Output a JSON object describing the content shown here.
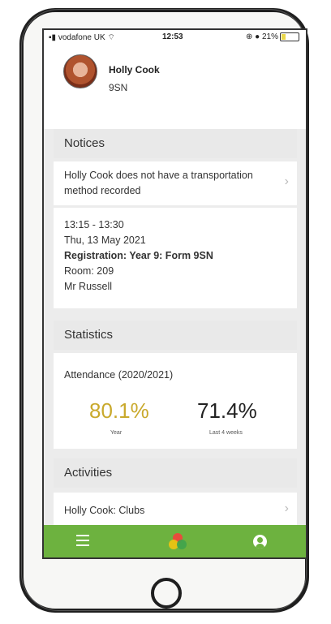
{
  "status_bar": {
    "carrier": "vodafone UK",
    "time": "12:53",
    "battery": "21%"
  },
  "profile": {
    "name": "Holly Cook",
    "form": "9SN"
  },
  "notices": {
    "title": "Notices",
    "transport_notice": "Holly Cook does not have a transportation method recorded",
    "registration": {
      "time": "13:15 - 13:30",
      "date": "Thu, 13 May 2021",
      "event": "Registration: Year 9: Form 9SN",
      "room": "Room: 209",
      "teacher": "Mr Russell"
    }
  },
  "statistics": {
    "title": "Statistics",
    "attendance_label": "Attendance (2020/2021)",
    "year_value": "80.1%",
    "year_label": "Year",
    "recent_value": "71.4%",
    "recent_label": "Last 4 weeks"
  },
  "activities": {
    "title": "Activities",
    "item": "Holly Cook: Clubs"
  },
  "colors": {
    "nav_green": "#6db23f",
    "year_gold": "#c9a92c"
  },
  "icons": [
    "wifi-icon",
    "alarm-icon",
    "battery-icon",
    "chevron-right-icon",
    "menu-icon",
    "app-logo-icon",
    "user-icon"
  ]
}
